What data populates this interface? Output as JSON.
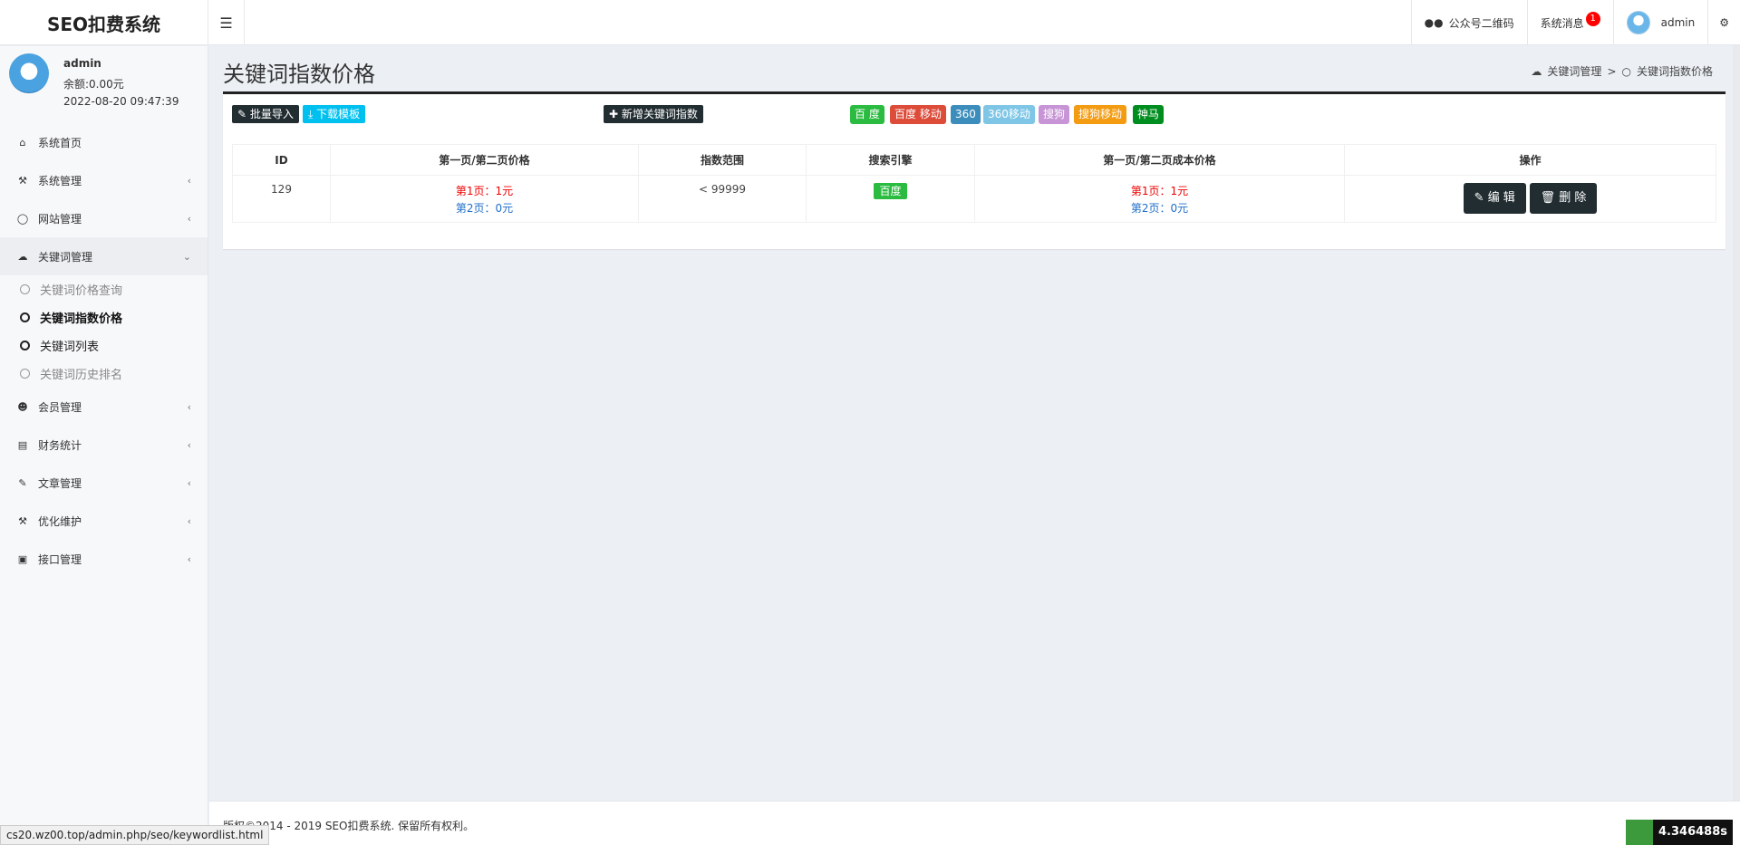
{
  "header": {
    "brand": "SEO扣费系统",
    "menu_toggle_icon": "bars-icon",
    "wechat_label": "公众号二维码",
    "messages_label": "系统消息",
    "messages_count": "1",
    "user_label": "admin"
  },
  "sidebar": {
    "user": {
      "name": "admin",
      "balance": "余额:0.00元",
      "time": "2022-08-20 09:47:39"
    },
    "items": [
      {
        "label": "系统首页",
        "icon": "home-icon"
      },
      {
        "label": "系统管理",
        "icon": "wrench-icon"
      },
      {
        "label": "网站管理",
        "icon": "circle-icon"
      },
      {
        "label": "关键词管理",
        "icon": "cloud-icon"
      },
      {
        "label": "会员管理",
        "icon": "users-icon"
      },
      {
        "label": "财务统计",
        "icon": "credit-card-icon"
      },
      {
        "label": "文章管理",
        "icon": "edit-icon"
      },
      {
        "label": "优化维护",
        "icon": "gavel-icon"
      },
      {
        "label": "接口管理",
        "icon": "book-icon"
      }
    ],
    "subitems": [
      {
        "label": "关键词价格查询"
      },
      {
        "label": "关键词指数价格"
      },
      {
        "label": "关键词列表"
      },
      {
        "label": "关键词历史排名"
      }
    ]
  },
  "main": {
    "title": "关键词指数价格",
    "breadcrumb": [
      "关键词管理",
      "关键词指数价格"
    ],
    "buttons": {
      "import": "批量导入",
      "download": "下载模板",
      "add": "新增关键词指数"
    },
    "engines": [
      {
        "label": "百 度",
        "color": "#2bbb40"
      },
      {
        "label": "百度 移动",
        "color": "#dd4b39"
      },
      {
        "label": "360",
        "color": "#3c8dbc"
      },
      {
        "label": "360移动",
        "color": "#7fc6e6"
      },
      {
        "label": "搜狗",
        "color": "#c795d6"
      },
      {
        "label": "搜狗移动",
        "color": "#f39c12"
      },
      {
        "label": "神马",
        "color": "#008d1f"
      }
    ],
    "table": {
      "headers": [
        "ID",
        "第一页/第二页价格",
        "指数范围",
        "搜索引擎",
        "第一页/第二页成本价格",
        "操作"
      ],
      "rows": [
        {
          "id": "129",
          "price_p1": "第1页：1元",
          "price_p2": "第2页：0元",
          "range": "< 99999",
          "engine": "百度",
          "cost_p1": "第1页：1元",
          "cost_p2": "第2页：0元",
          "edit": "编 辑",
          "delete": "删 除"
        }
      ]
    }
  },
  "footer": {
    "copyright": "版权©2014 - 2019 SEO扣费系统. 保留所有权利。"
  },
  "statusbar": {
    "url": "cs20.wz00.top/admin.php/seo/keywordlist.html",
    "timer": "4.346488s"
  }
}
